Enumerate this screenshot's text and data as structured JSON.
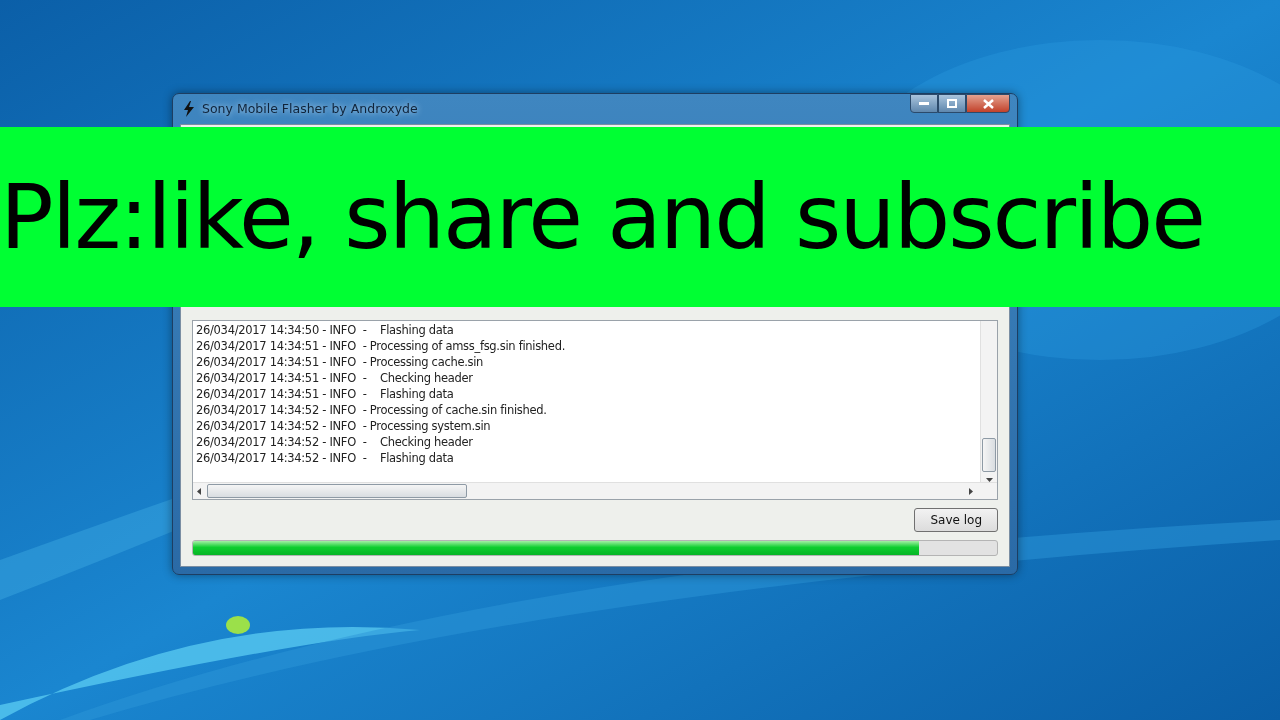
{
  "window": {
    "title": "Sony Mobile Flasher by Androxyde"
  },
  "log": {
    "lines": [
      "26/034/2017 14:34:50 - INFO  -    Flashing data",
      "26/034/2017 14:34:51 - INFO  - Processing of amss_fsg.sin finished.",
      "26/034/2017 14:34:51 - INFO  - Processing cache.sin",
      "26/034/2017 14:34:51 - INFO  -    Checking header",
      "26/034/2017 14:34:51 - INFO  -    Flashing data",
      "26/034/2017 14:34:52 - INFO  - Processing of cache.sin finished.",
      "26/034/2017 14:34:52 - INFO  - Processing system.sin",
      "26/034/2017 14:34:52 - INFO  -    Checking header",
      "26/034/2017 14:34:52 - INFO  -    Flashing data"
    ]
  },
  "buttons": [
    {
      "label": "Save log"
    }
  ],
  "progress": {
    "level": 0.903
  },
  "banner": {
    "text": "Plz:like, share and subscribe"
  }
}
